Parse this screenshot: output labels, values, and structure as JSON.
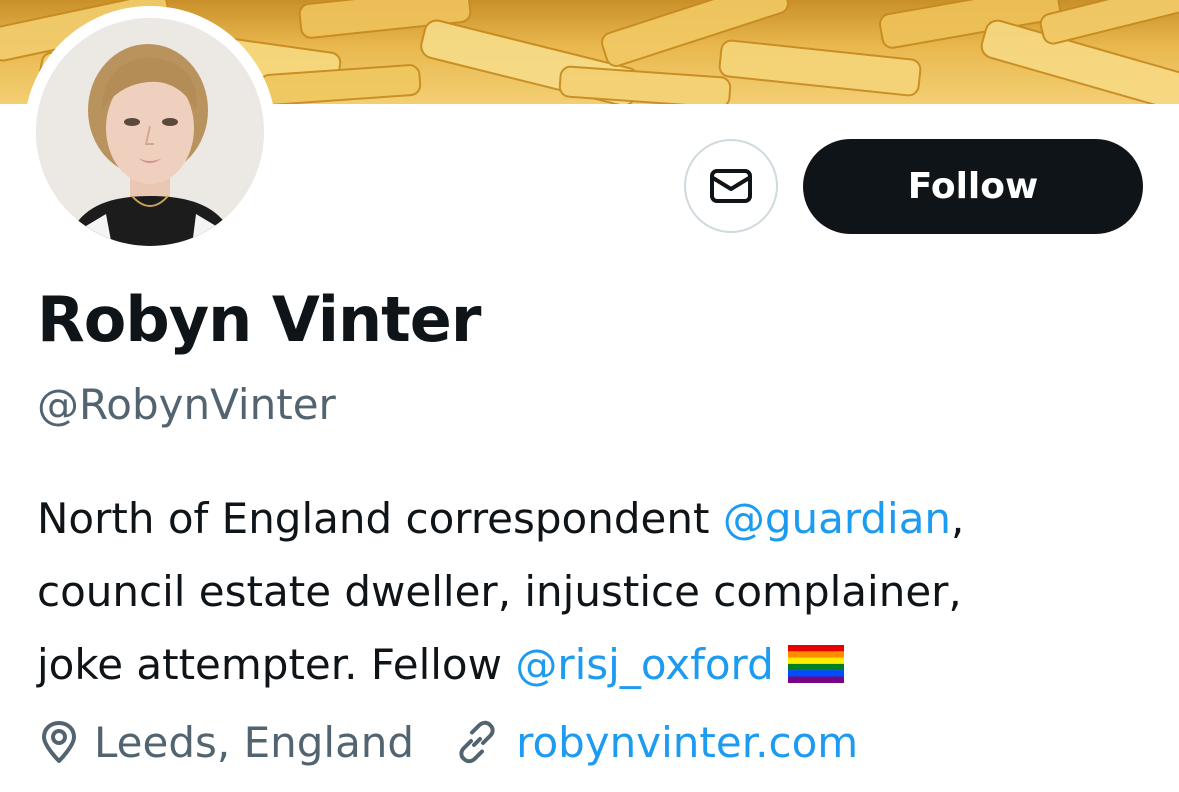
{
  "banner": {
    "description_icon": "fries-header-image"
  },
  "avatar": {
    "icon": "profile-photo"
  },
  "actions": {
    "message_icon": "envelope-icon",
    "follow_label": "Follow"
  },
  "profile": {
    "name": "Robyn Vinter",
    "handle": "@RobynVinter"
  },
  "bio": {
    "line1_text": "North of England correspondent ",
    "line1_mention": "@guardian",
    "line1_end": ",",
    "line2_text": "council estate dweller, injustice complainer,",
    "line3_text": "joke attempter. Fellow ",
    "line3_mention": "@risj_oxford",
    "flag_icon": "rainbow-flag-icon"
  },
  "meta": {
    "location_icon": "location-pin-icon",
    "location": "Leeds, England",
    "website_icon": "link-icon",
    "website": "robynvinter.com"
  },
  "colors": {
    "accent": "#1d9bf0",
    "text": "#0f1419",
    "secondary": "#536471",
    "button_bg": "#0f1419"
  }
}
